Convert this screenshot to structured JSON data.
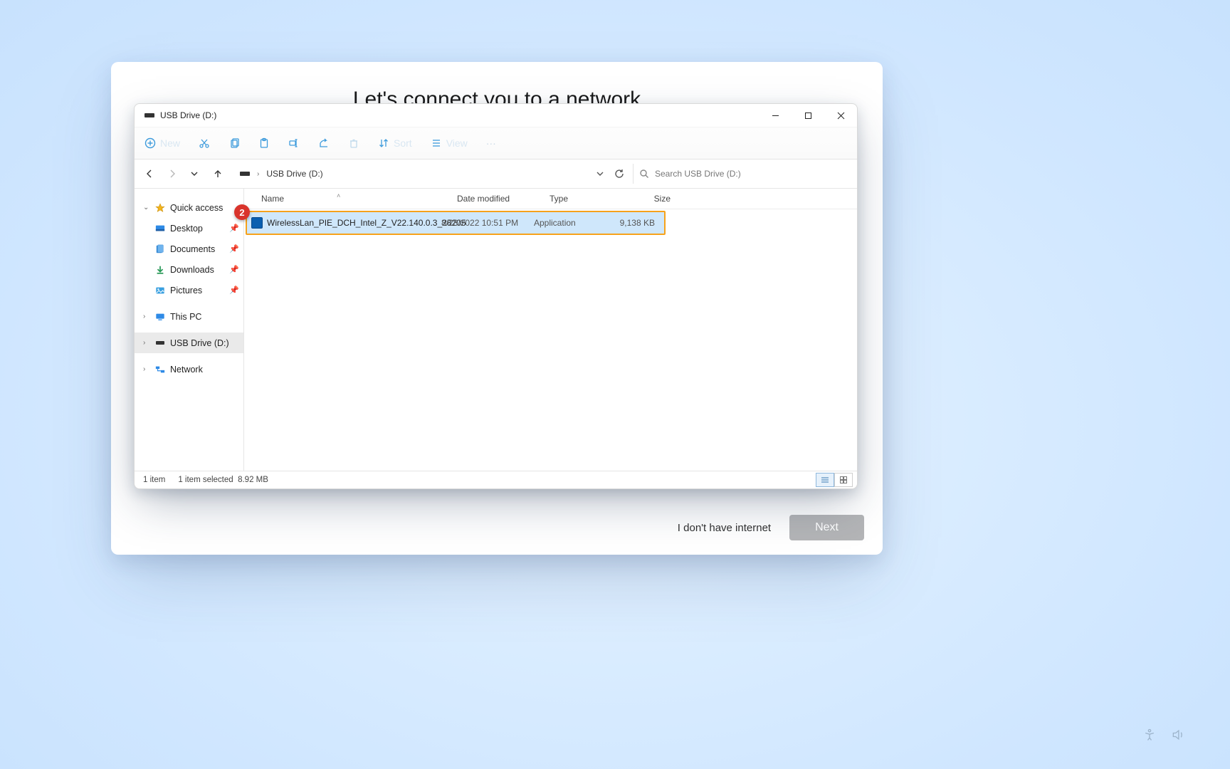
{
  "oobe": {
    "heading": "Let's connect you to a network",
    "no_internet": "I don't have internet",
    "next": "Next"
  },
  "window": {
    "title": "USB Drive (D:)",
    "crumb": "USB Drive (D:)",
    "search_placeholder": "Search USB Drive (D:)"
  },
  "toolbar": {
    "new": "New",
    "sort": "Sort",
    "view": "View",
    "more": "···"
  },
  "nav": {
    "quick_access": "Quick access",
    "desktop": "Desktop",
    "documents": "Documents",
    "downloads": "Downloads",
    "pictures": "Pictures",
    "this_pc": "This PC",
    "usb_drive": "USB Drive (D:)",
    "network": "Network"
  },
  "columns": {
    "name": "Name",
    "date": "Date modified",
    "type": "Type",
    "size": "Size"
  },
  "rows": [
    {
      "name": "WirelessLan_PIE_DCH_Intel_Z_V22.140.0.3_28205",
      "date": "8/28/2022 10:51 PM",
      "type": "Application",
      "size": "9,138 KB"
    }
  ],
  "status": {
    "items": "1 item",
    "selected": "1 item selected",
    "sel_size": "8.92 MB"
  },
  "annotation": {
    "step": "2"
  }
}
